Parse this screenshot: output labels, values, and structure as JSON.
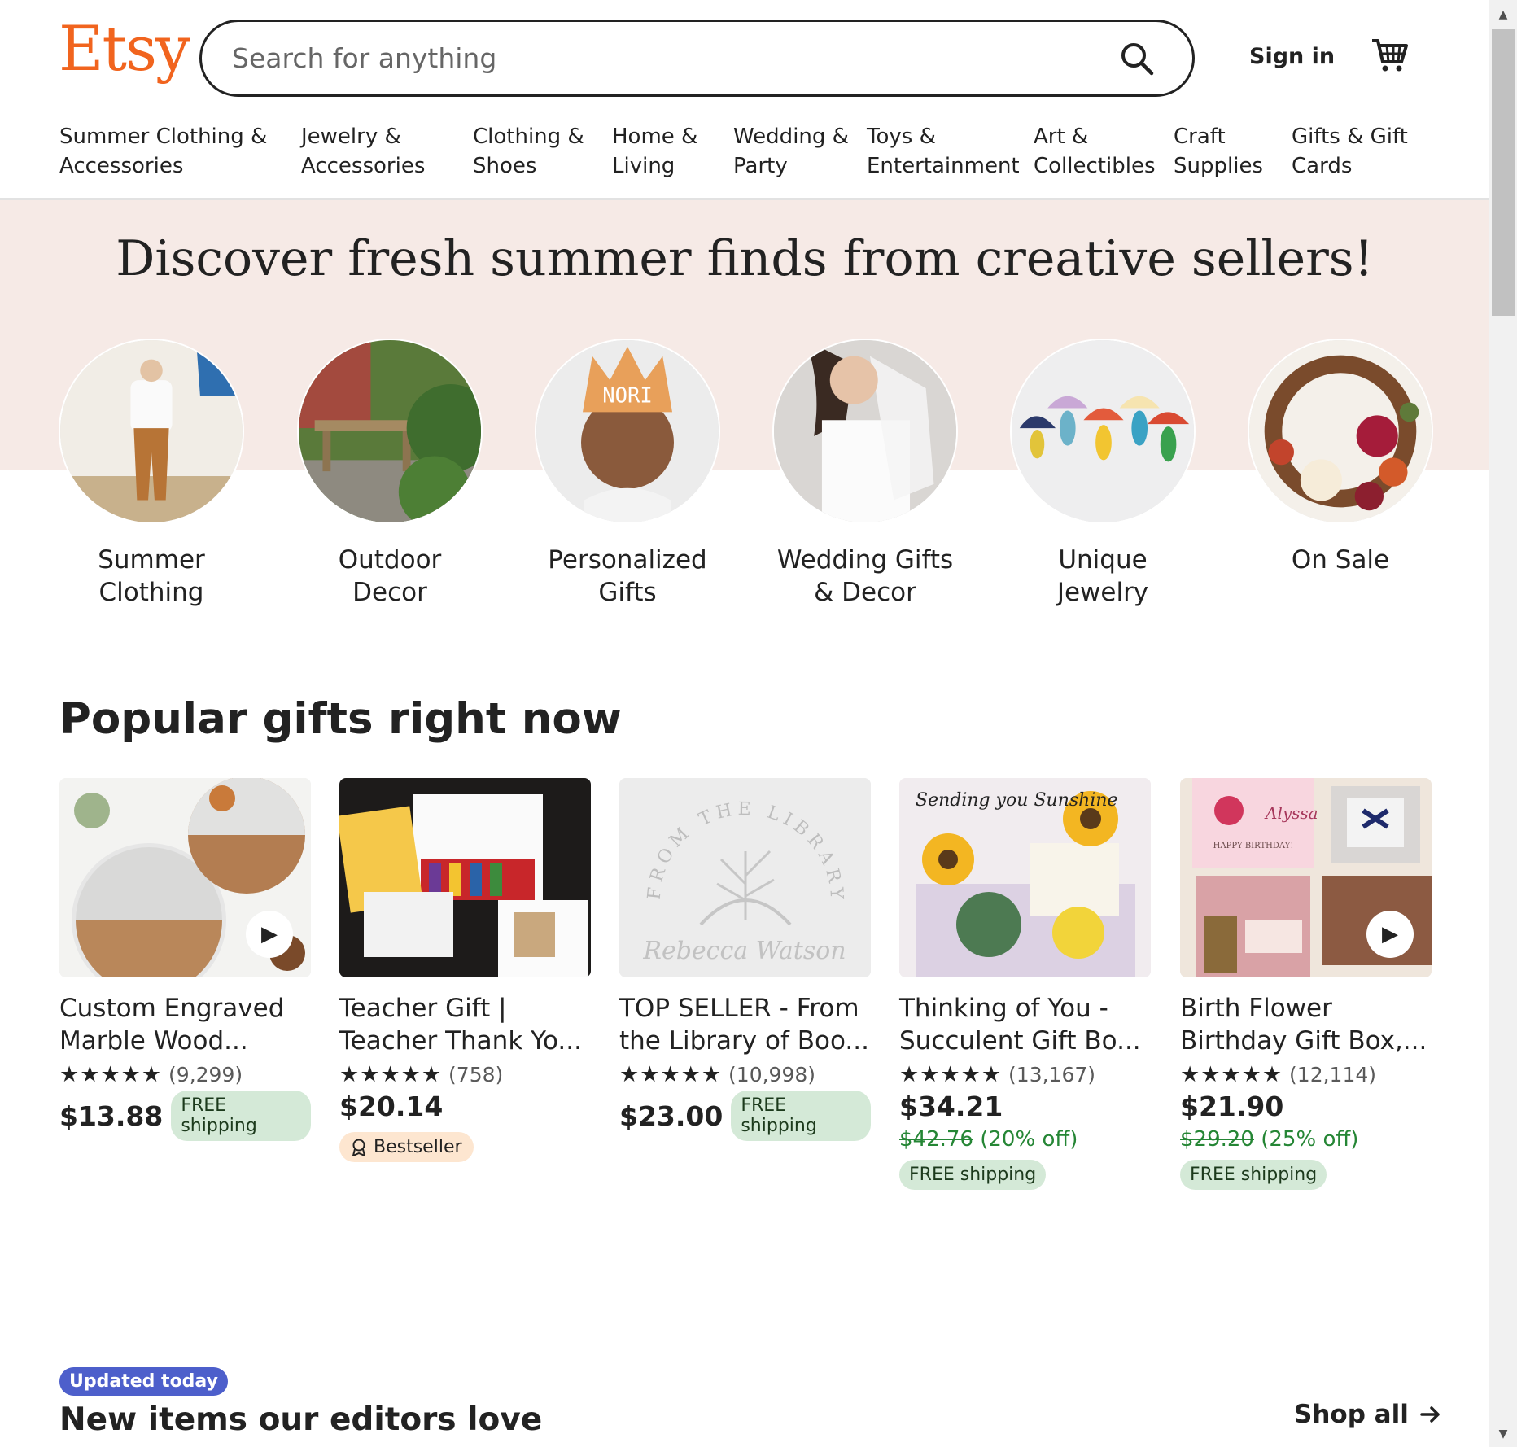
{
  "header": {
    "logo": "Etsy",
    "search_placeholder": "Search for anything",
    "sign_in": "Sign in",
    "search_icon": "search-icon",
    "cart_icon": "cart-icon"
  },
  "nav": [
    {
      "line1": "Summer Clothing &",
      "line2": "Accessories"
    },
    {
      "line1": "Jewelry &",
      "line2": "Accessories"
    },
    {
      "line1": "Clothing &",
      "line2": "Shoes"
    },
    {
      "line1": "Home &",
      "line2": "Living"
    },
    {
      "line1": "Wedding &",
      "line2": "Party"
    },
    {
      "line1": "Toys &",
      "line2": "Entertainment"
    },
    {
      "line1": "Art &",
      "line2": "Collectibles"
    },
    {
      "line1": "Craft",
      "line2": "Supplies"
    },
    {
      "line1": "Gifts & Gift",
      "line2": "Cards"
    }
  ],
  "hero": {
    "title": "Discover fresh summer finds from creative sellers!",
    "categories": [
      {
        "line1": "Summer",
        "line2": "Clothing"
      },
      {
        "line1": "Outdoor",
        "line2": "Decor"
      },
      {
        "line1": "Personalized",
        "line2": "Gifts"
      },
      {
        "line1": "Wedding Gifts",
        "line2": "& Decor"
      },
      {
        "line1": "Unique",
        "line2": "Jewelry"
      },
      {
        "line1": "On Sale",
        "line2": ""
      }
    ]
  },
  "popular": {
    "title": "Popular gifts right now",
    "items": [
      {
        "title_line1": "Custom Engraved",
        "title_line2": "Marble Wood...",
        "stars": "★★★★★",
        "count": "(9,299)",
        "price": "$13.88",
        "shipping": "FREE shipping",
        "has_video": true
      },
      {
        "title_line1": "Teacher Gift |",
        "title_line2": "Teacher Thank Yo...",
        "stars": "★★★★★",
        "count": "(758)",
        "price": "$20.14",
        "badge": "Bestseller",
        "has_video": false
      },
      {
        "title_line1": "TOP SELLER - From",
        "title_line2": "the Library of Boo...",
        "stars": "★★★★★",
        "count": "(10,998)",
        "price": "$23.00",
        "shipping": "FREE shipping",
        "has_video": false
      },
      {
        "title_line1": "Thinking of You -",
        "title_line2": "Succulent Gift Bo...",
        "stars": "★★★★★",
        "count": "(13,167)",
        "price": "$34.21",
        "original": "$42.76",
        "discount": "(20% off)",
        "shipping": "FREE shipping",
        "has_video": false
      },
      {
        "title_line1": "Birth Flower",
        "title_line2": "Birthday Gift Box,...",
        "stars": "★★★★★",
        "count": "(12,114)",
        "price": "$21.90",
        "original": "$29.20",
        "discount": "(25% off)",
        "shipping": "FREE shipping",
        "has_video": true
      }
    ]
  },
  "image_text": {
    "nori": "NORI",
    "library_top": "FROM THE LIBRARY OF",
    "library_name": "Rebecca Watson",
    "sunshine": "Sending you Sunshine",
    "alyssa": "Alyssa",
    "happy_birthday": "HAPPY BIRTHDAY!"
  },
  "editors": {
    "badge": "Updated today",
    "title": "New items our editors love",
    "shop_all": "Shop all"
  },
  "colors": {
    "brand": "#f1641e",
    "hero_bg": "#f6eae6",
    "free_shipping_bg": "#d4e9d7",
    "sale_green": "#258635",
    "badge_blue": "#4d5fcb"
  }
}
